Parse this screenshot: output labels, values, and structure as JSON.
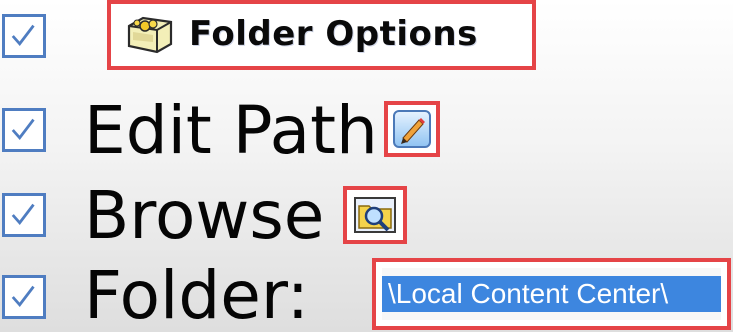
{
  "folder_options": {
    "title": "Folder Options",
    "icon": "folder-options-icon"
  },
  "items": [
    {
      "label": "Edit Path",
      "checked": true,
      "icon": "edit-pencil-icon"
    },
    {
      "label": "Browse",
      "checked": true,
      "icon": "browse-folder-icon"
    },
    {
      "label": "Folder:",
      "checked": true,
      "value": "\\Local Content Center\\"
    }
  ],
  "colors": {
    "highlight": "#e54447",
    "checkbox": "#4f7dc1",
    "selection": "#3d86df"
  }
}
